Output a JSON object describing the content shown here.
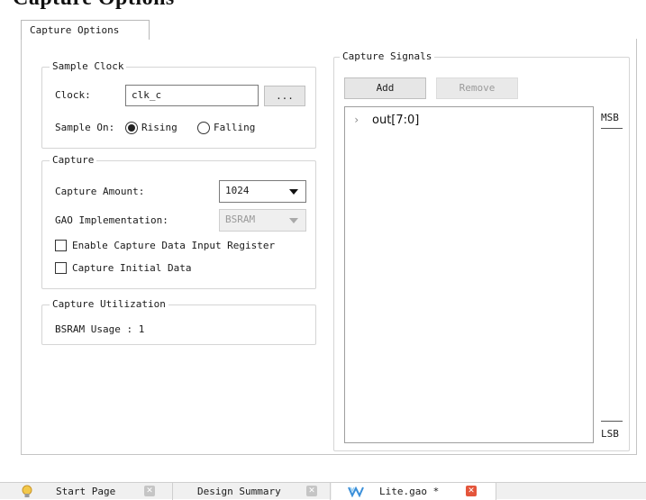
{
  "page_heading": "Capture Options",
  "tabs": {
    "capture_options": "Capture Options"
  },
  "sample_clock": {
    "title": "Sample Clock",
    "clock_label": "Clock:",
    "clock_value": "clk_c",
    "browse_label": "...",
    "sample_on_label": "Sample On:",
    "rising_label": "Rising",
    "falling_label": "Falling",
    "selected": "Rising"
  },
  "capture": {
    "title": "Capture",
    "amount_label": "Capture Amount:",
    "amount_value": "1024",
    "impl_label": "GAO Implementation:",
    "impl_value": "BSRAM",
    "enable_input_register_label": "Enable Capture Data Input Register",
    "enable_input_register_checked": false,
    "initial_data_label": "Capture Initial Data",
    "initial_data_checked": false
  },
  "utilization": {
    "title": "Capture Utilization",
    "bsram_usage": "BSRAM Usage : 1"
  },
  "signals": {
    "title": "Capture Signals",
    "add_label": "Add",
    "remove_label": "Remove",
    "items": [
      {
        "label": "out[7:0]"
      }
    ],
    "msb_label": "MSB",
    "lsb_label": "LSB"
  },
  "bottom_tabs": [
    {
      "label": "Start Page",
      "icon": "lightbulb-icon"
    },
    {
      "label": "Design Summary",
      "icon": "none"
    },
    {
      "label": "Lite.gao *",
      "icon": "gao-logo-icon",
      "active": true
    }
  ],
  "colors": {
    "close_active": "#e4553b",
    "close_inactive": "#c5c5c5",
    "gao_logo": "#3a8fd9"
  }
}
